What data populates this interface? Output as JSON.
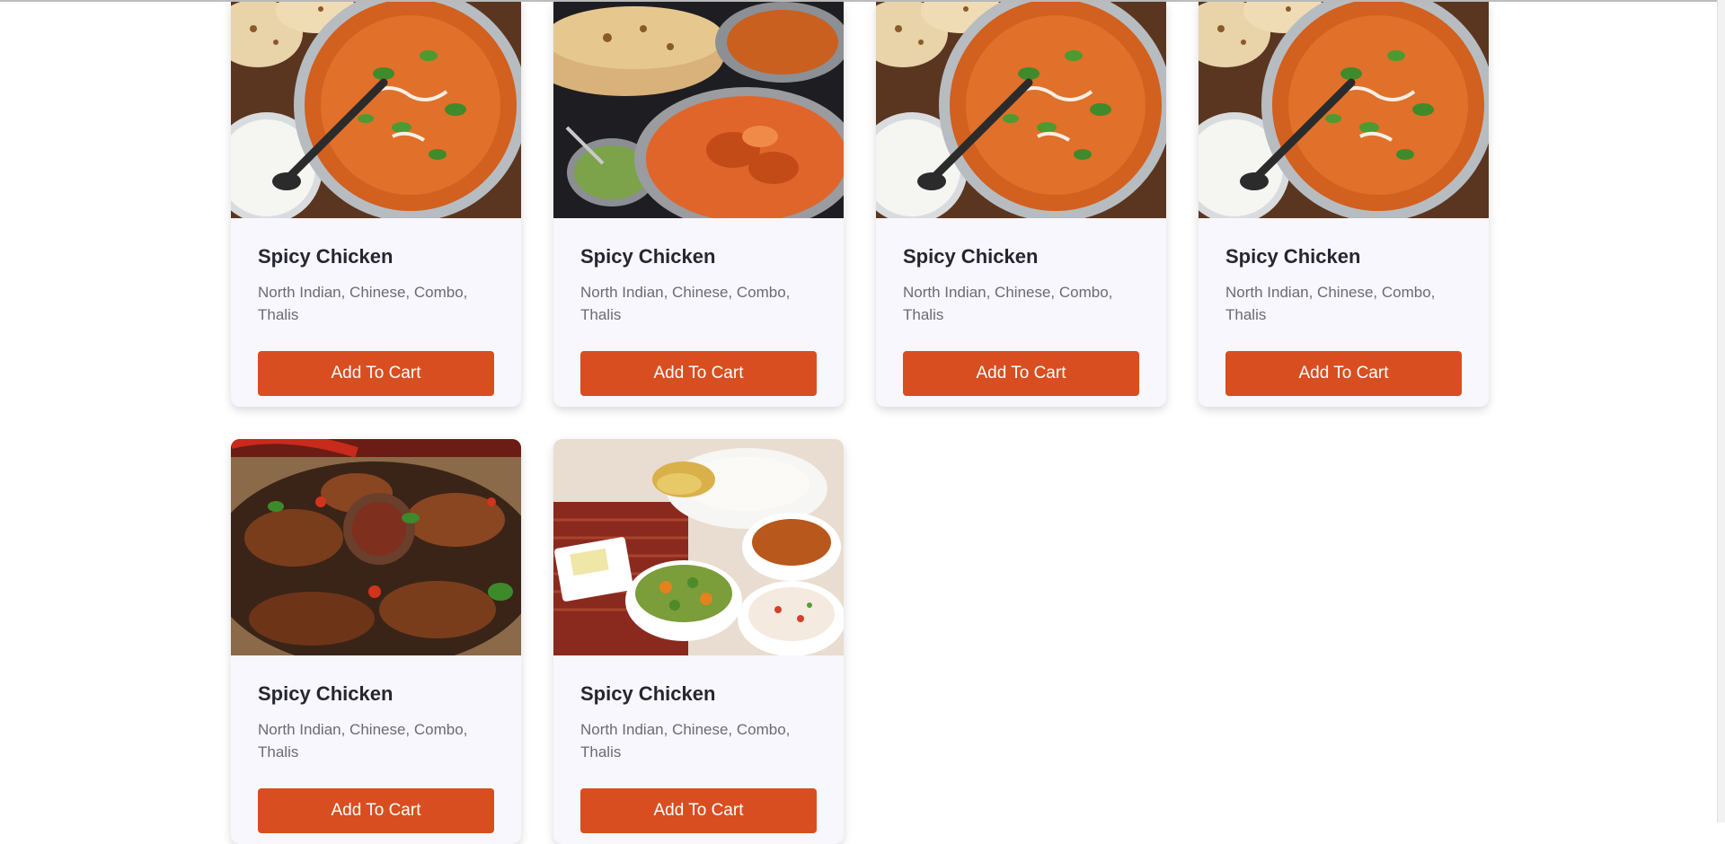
{
  "colors": {
    "button_bg": "#d84e20",
    "card_bg": "#f8f7fd",
    "title": "#262631",
    "desc": "#6b6b73"
  },
  "cards": [
    {
      "title": "Spicy Chicken",
      "desc": "North Indian, Chinese, Combo, Thalis",
      "button": "Add To Cart",
      "image": "butter-chicken-pan-photo"
    },
    {
      "title": "Spicy Chicken",
      "desc": "North Indian, Chinese, Combo, Thalis",
      "button": "Add To Cart",
      "image": "naan-curry-chutney-photo"
    },
    {
      "title": "Spicy Chicken",
      "desc": "North Indian, Chinese, Combo, Thalis",
      "button": "Add To Cart",
      "image": "butter-chicken-pan-photo"
    },
    {
      "title": "Spicy Chicken",
      "desc": "North Indian, Chinese, Combo, Thalis",
      "button": "Add To Cart",
      "image": "butter-chicken-pan-photo"
    },
    {
      "title": "Spicy Chicken",
      "desc": "North Indian, Chinese, Combo, Thalis",
      "button": "Add To Cart",
      "image": "chicken-wings-sauce-photo"
    },
    {
      "title": "Spicy Chicken",
      "desc": "North Indian, Chinese, Combo, Thalis",
      "button": "Add To Cart",
      "image": "thali-platter-photo"
    }
  ]
}
